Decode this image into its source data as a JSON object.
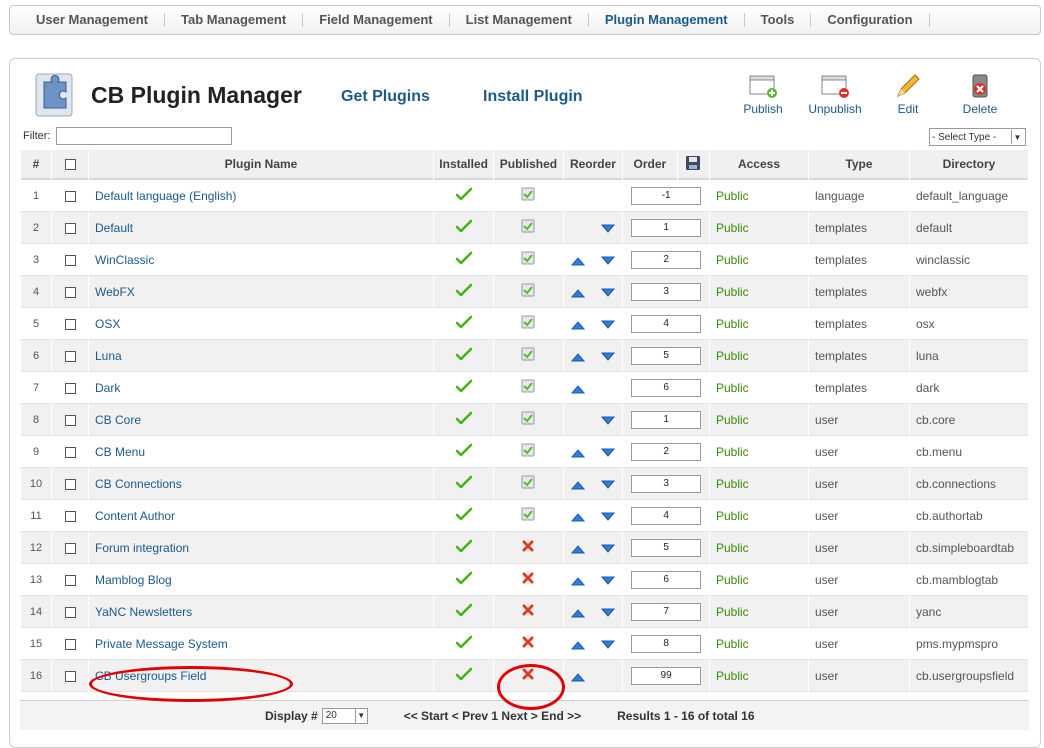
{
  "topmenu": [
    {
      "label": "User Management",
      "active": false
    },
    {
      "label": "Tab Management",
      "active": false
    },
    {
      "label": "Field Management",
      "active": false
    },
    {
      "label": "List Management",
      "active": false
    },
    {
      "label": "Plugin Management",
      "active": true
    },
    {
      "label": "Tools",
      "active": false
    },
    {
      "label": "Configuration",
      "active": false
    }
  ],
  "header": {
    "title": "CB Plugin Manager",
    "get_plugins": "Get Plugins",
    "install_plugin": "Install Plugin",
    "icon": "puzzle-piece-icon"
  },
  "toolbar": {
    "publish": "Publish",
    "unpublish": "Unpublish",
    "edit": "Edit",
    "delete": "Delete"
  },
  "filter": {
    "label": "Filter:",
    "value": "",
    "type_select": "- Select Type -"
  },
  "columns": {
    "num": "#",
    "name": "Plugin Name",
    "installed": "Installed",
    "published": "Published",
    "reorder": "Reorder",
    "order": "Order",
    "access": "Access",
    "type": "Type",
    "directory": "Directory"
  },
  "rows": [
    {
      "num": "1",
      "name": "Default language (English)",
      "published": true,
      "up": false,
      "down": false,
      "order": "-1",
      "access": "Public",
      "type": "language",
      "dir": "default_language"
    },
    {
      "num": "2",
      "name": "Default",
      "published": true,
      "up": false,
      "down": true,
      "order": "1",
      "access": "Public",
      "type": "templates",
      "dir": "default"
    },
    {
      "num": "3",
      "name": "WinClassic",
      "published": true,
      "up": true,
      "down": true,
      "order": "2",
      "access": "Public",
      "type": "templates",
      "dir": "winclassic"
    },
    {
      "num": "4",
      "name": "WebFX",
      "published": true,
      "up": true,
      "down": true,
      "order": "3",
      "access": "Public",
      "type": "templates",
      "dir": "webfx"
    },
    {
      "num": "5",
      "name": "OSX",
      "published": true,
      "up": true,
      "down": true,
      "order": "4",
      "access": "Public",
      "type": "templates",
      "dir": "osx"
    },
    {
      "num": "6",
      "name": "Luna",
      "published": true,
      "up": true,
      "down": true,
      "order": "5",
      "access": "Public",
      "type": "templates",
      "dir": "luna"
    },
    {
      "num": "7",
      "name": "Dark",
      "published": true,
      "up": true,
      "down": false,
      "order": "6",
      "access": "Public",
      "type": "templates",
      "dir": "dark"
    },
    {
      "num": "8",
      "name": "CB Core",
      "published": true,
      "up": false,
      "down": true,
      "order": "1",
      "access": "Public",
      "type": "user",
      "dir": "cb.core"
    },
    {
      "num": "9",
      "name": "CB Menu",
      "published": true,
      "up": true,
      "down": true,
      "order": "2",
      "access": "Public",
      "type": "user",
      "dir": "cb.menu"
    },
    {
      "num": "10",
      "name": "CB Connections",
      "published": true,
      "up": true,
      "down": true,
      "order": "3",
      "access": "Public",
      "type": "user",
      "dir": "cb.connections"
    },
    {
      "num": "11",
      "name": "Content Author",
      "published": true,
      "up": true,
      "down": true,
      "order": "4",
      "access": "Public",
      "type": "user",
      "dir": "cb.authortab"
    },
    {
      "num": "12",
      "name": "Forum integration",
      "published": false,
      "up": true,
      "down": true,
      "order": "5",
      "access": "Public",
      "type": "user",
      "dir": "cb.simpleboardtab"
    },
    {
      "num": "13",
      "name": "Mamblog Blog",
      "published": false,
      "up": true,
      "down": true,
      "order": "6",
      "access": "Public",
      "type": "user",
      "dir": "cb.mamblogtab"
    },
    {
      "num": "14",
      "name": "YaNC Newsletters",
      "published": false,
      "up": true,
      "down": true,
      "order": "7",
      "access": "Public",
      "type": "user",
      "dir": "yanc"
    },
    {
      "num": "15",
      "name": "Private Message System",
      "published": false,
      "up": true,
      "down": true,
      "order": "8",
      "access": "Public",
      "type": "user",
      "dir": "pms.mypmspro"
    },
    {
      "num": "16",
      "name": "CB Usergroups Field",
      "published": false,
      "up": true,
      "down": false,
      "order": "99",
      "access": "Public",
      "type": "user",
      "dir": "cb.usergroupsfield"
    }
  ],
  "footer": {
    "display_label": "Display #",
    "display_value": "20",
    "pagination": "<< Start < Prev 1 Next > End >>",
    "results": "Results 1 - 16 of total 16"
  },
  "colors": {
    "link": "#1b5a8a",
    "access": "#3a8a0a",
    "highlight": "#e30000"
  }
}
